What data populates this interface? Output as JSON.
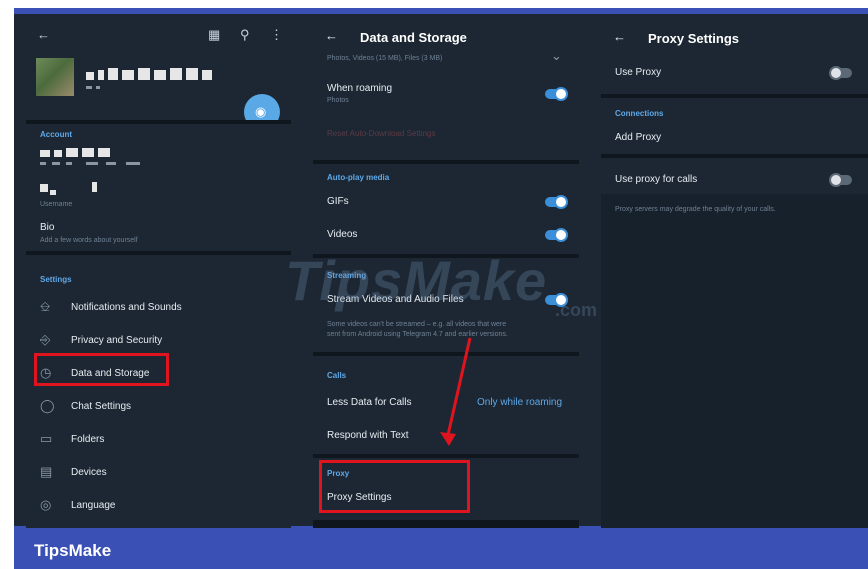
{
  "left_panel": {
    "account_section": "Account",
    "username_hint": "Username",
    "bio_label": "Bio",
    "bio_hint": "Add a few words about yourself",
    "settings_section": "Settings",
    "items": [
      {
        "label": "Notifications and Sounds",
        "icon": "bell-icon"
      },
      {
        "label": "Privacy and Security",
        "icon": "lock-icon"
      },
      {
        "label": "Data and Storage",
        "icon": "clock-icon"
      },
      {
        "label": "Chat Settings",
        "icon": "chat-bubble-icon"
      },
      {
        "label": "Folders",
        "icon": "folder-icon"
      },
      {
        "label": "Devices",
        "icon": "devices-icon"
      },
      {
        "label": "Language",
        "icon": "globe-icon"
      }
    ]
  },
  "middle_panel": {
    "title": "Data and Storage",
    "top_sub": "Photos, Videos (15 MB), Files (3 MB)",
    "roaming_label": "When roaming",
    "roaming_sub": "Photos",
    "reset_label": "Reset Auto-Download Settings",
    "autoplay_section": "Auto-play media",
    "gifs_label": "GIFs",
    "videos_label": "Videos",
    "streaming_section": "Streaming",
    "stream_label": "Stream Videos and Audio Files",
    "stream_note_1": "Some videos can't be streamed – e.g. all videos that were",
    "stream_note_2": "sent from Android using Telegram 4.7 and earlier versions.",
    "calls_section": "Calls",
    "less_data_label": "Less Data for Calls",
    "less_data_value": "Only while roaming",
    "respond_label": "Respond with Text",
    "proxy_section": "Proxy",
    "proxy_settings_label": "Proxy Settings"
  },
  "right_panel": {
    "title": "Proxy Settings",
    "use_proxy_label": "Use Proxy",
    "connections_section": "Connections",
    "add_proxy_label": "Add Proxy",
    "use_proxy_calls_label": "Use proxy for calls",
    "calls_note": "Proxy servers may degrade the quality of your calls."
  },
  "toggles": {
    "when_roaming": true,
    "gifs": true,
    "videos": true,
    "stream": true,
    "use_proxy": false,
    "use_proxy_calls": false
  },
  "watermark": {
    "text": "TipsMake",
    "suffix": ".com"
  },
  "footer": {
    "label": "TipsMake"
  },
  "colors": {
    "accent": "#5fa8e8",
    "highlight": "#e0141e",
    "brand": "#3a50b4"
  }
}
